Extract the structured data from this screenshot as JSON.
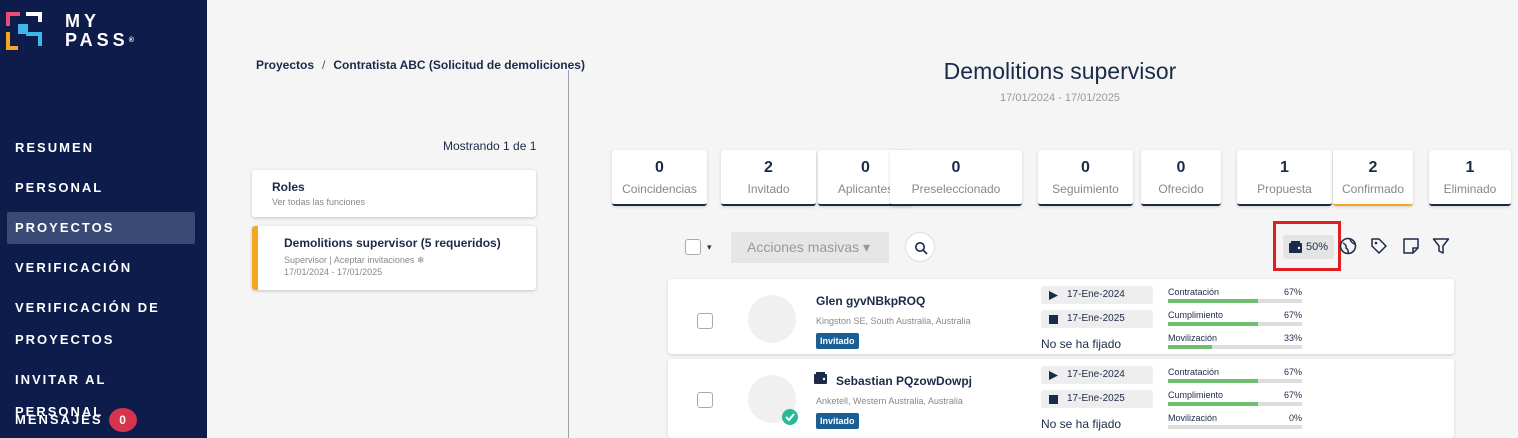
{
  "sidebar": {
    "logo_text_1": "MY",
    "logo_text_2": "PASS",
    "logo_reg": "®",
    "items": [
      {
        "label": "RESUMEN"
      },
      {
        "label": "PERSONAL"
      },
      {
        "label": "PROYECTOS"
      },
      {
        "label": "VERIFICACIÓN"
      },
      {
        "label": "VERIFICACIÓN DE"
      },
      {
        "label": "PROYECTOS"
      },
      {
        "label": "INVITAR AL PERSONAL"
      },
      {
        "label": "MENSAJES"
      }
    ],
    "messages_count": "0"
  },
  "breadcrumb": {
    "root": "Proyectos",
    "separator": "/",
    "current": "Contratista ABC (Solicitud de demoliciones)"
  },
  "left": {
    "showing": "Mostrando 1 de 1",
    "roles_title": "Roles",
    "roles_sub": "Ver todas las funciones",
    "project_title": "Demolitions supervisor (5 requeridos)",
    "project_sub": "Supervisor | Aceptar invitaciones ❄",
    "project_dates": "17/01/2024 - 17/01/2025"
  },
  "header": {
    "title": "Demolitions supervisor",
    "dates": "17/01/2024 - 17/01/2025"
  },
  "stages": [
    {
      "count": "0",
      "label": "Coincidencias"
    },
    {
      "count": "2",
      "label": "Invitado"
    },
    {
      "count": "0",
      "label": "Aplicantes"
    },
    {
      "count": "0",
      "label": "Preseleccionado"
    },
    {
      "count": "0",
      "label": "Seguimiento"
    },
    {
      "count": "0",
      "label": "Ofrecido"
    },
    {
      "count": "1",
      "label": "Propuesta"
    },
    {
      "count": "2",
      "label": "Confirmado"
    },
    {
      "count": "1",
      "label": "Eliminado"
    }
  ],
  "toolbar": {
    "bulk_label": "Acciones masivas",
    "bulk_caret": "▾",
    "select_caret": "▾",
    "percent_label": "50%",
    "icons": [
      "wallet-icon",
      "search-icon",
      "globe-icon",
      "tag-icon",
      "note-icon",
      "filter-icon"
    ]
  },
  "candidates": [
    {
      "name": "Glen gyvNBkpROQ",
      "location": "Kingston SE, South Australia, Australia",
      "status": "Invitado",
      "start": "17-Ene-2024",
      "end": "17-Ene-2025",
      "not_set": "No se ha fijado",
      "metrics": [
        {
          "label": "Contratación",
          "value": "67%",
          "fraction": 0.67
        },
        {
          "label": "Cumplimiento",
          "value": "67%",
          "fraction": 0.67
        },
        {
          "label": "Movilización",
          "value": "33%",
          "fraction": 0.33
        }
      ]
    },
    {
      "name": "Sebastian PQzowDowpj",
      "location": "Anketell, Western Australia, Australia",
      "status": "Invitado",
      "start": "17-Ene-2024",
      "end": "17-Ene-2025",
      "not_set": "No se ha fijado",
      "metrics": [
        {
          "label": "Contratación",
          "value": "67%",
          "fraction": 0.67
        },
        {
          "label": "Cumplimiento",
          "value": "67%",
          "fraction": 0.67
        },
        {
          "label": "Movilización",
          "value": "0%",
          "fraction": 0.0
        }
      ]
    }
  ],
  "colors": {
    "sidebar_bg": "#0e1c4b",
    "accent_orange": "#f5a623",
    "invited_badge": "#1a5e96",
    "progress_green": "#6dbe6d",
    "highlight_red": "#e02020",
    "messages_badge": "#d6334d"
  }
}
